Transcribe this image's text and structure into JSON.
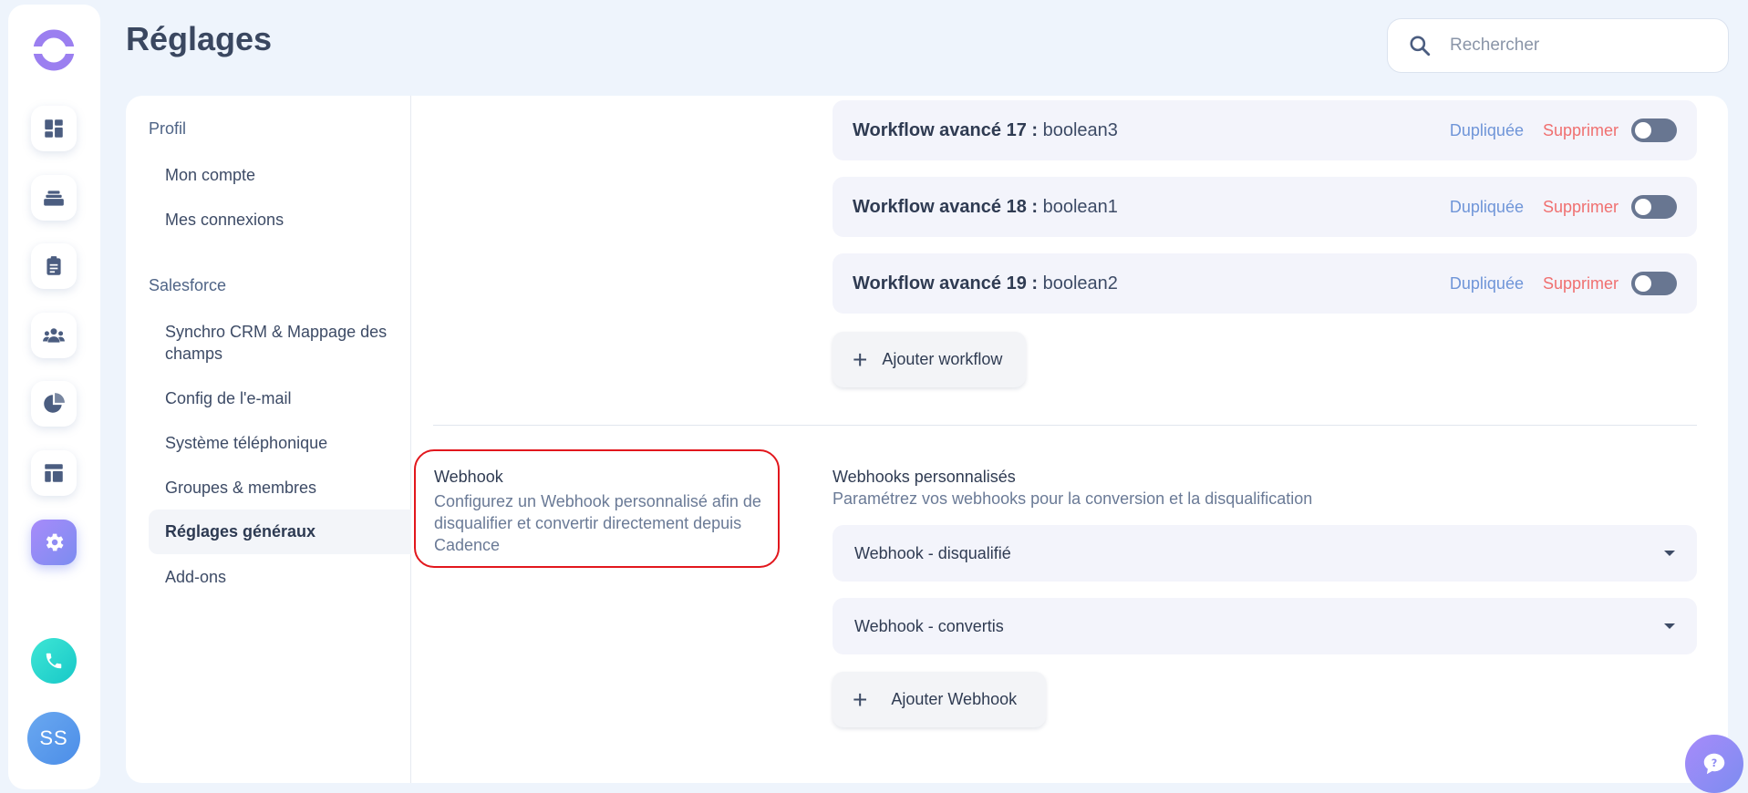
{
  "app": {
    "brand_colors": {
      "accent": "#a78bfa",
      "phone": "#22d3c8",
      "danger": "#f07070",
      "link": "#6f95d8",
      "highlight": "#e2171d"
    }
  },
  "rail": {
    "items": [
      {
        "icon": "dashboard-icon"
      },
      {
        "icon": "stack-icon"
      },
      {
        "icon": "clipboard-icon"
      },
      {
        "icon": "team-icon"
      },
      {
        "icon": "pie-chart-icon"
      },
      {
        "icon": "layout-icon"
      },
      {
        "icon": "gear-icon",
        "active": true
      }
    ],
    "phone_icon": "phone-icon",
    "avatar_initials": "SS"
  },
  "header": {
    "title": "Réglages",
    "search_placeholder": "Rechercher"
  },
  "nav": {
    "profile_section": "Profil",
    "profile_items": [
      "Mon compte",
      "Mes connexions"
    ],
    "salesforce_section": "Salesforce",
    "salesforce_items": [
      "Synchro CRM & Mappage des champs",
      "Config de l'e-mail",
      "Système téléphonique",
      "Groupes & membres",
      "Réglages généraux",
      "Add-ons"
    ],
    "active_item": "Réglages généraux"
  },
  "workflows": {
    "rows": [
      {
        "label": "Workflow avancé 17 :",
        "value": "boolean3",
        "duplicate": "Dupliquée",
        "delete": "Supprimer",
        "enabled": false
      },
      {
        "label": "Workflow avancé 18 :",
        "value": "boolean1",
        "duplicate": "Dupliquée",
        "delete": "Supprimer",
        "enabled": false
      },
      {
        "label": "Workflow avancé 19 :",
        "value": "boolean2",
        "duplicate": "Dupliquée",
        "delete": "Supprimer",
        "enabled": false
      }
    ],
    "add_label": "Ajouter workflow"
  },
  "webhook": {
    "title": "Webhook",
    "description": "Configurez un Webhook personnalisé afin de disqualifier et convertir directement depuis Cadence",
    "custom_title": "Webhooks personnalisés",
    "custom_description": "Paramétrez vos webhooks pour la conversion et la disqualification",
    "items": [
      "Webhook - disqualifié",
      "Webhook - convertis"
    ],
    "add_label": "Ajouter Webhook"
  },
  "chat_icon": "help-chat-icon"
}
